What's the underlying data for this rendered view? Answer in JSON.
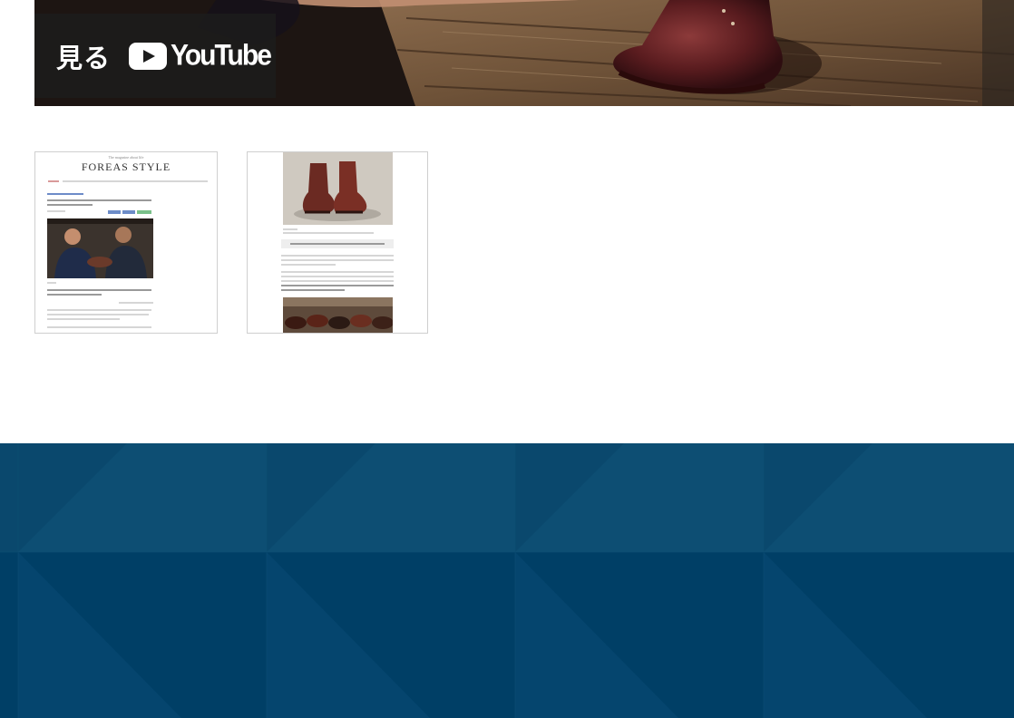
{
  "video": {
    "watch_label": "見る",
    "platform_label": "YouTube",
    "play_icon": "youtube-play-icon"
  },
  "thumbnails": [
    {
      "tagline": "The magazine about life",
      "logo_text": "FOREAS STYLE"
    },
    {}
  ],
  "colors": {
    "page_background": "#ffffff",
    "footer_background": "#003d63",
    "overlay_background": "#1c1c1c"
  }
}
